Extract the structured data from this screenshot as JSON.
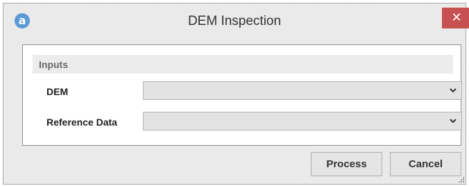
{
  "window": {
    "title": "DEM Inspection",
    "logo_glyph": "a",
    "logo_icon": "app-logo-icon",
    "close_glyph": "✕",
    "close_icon": "close-icon",
    "close_color": "#c75050"
  },
  "inputs": {
    "header": "Inputs",
    "fields": [
      {
        "label": "DEM",
        "value": "",
        "icon": "chevron-down-icon"
      },
      {
        "label": "Reference Data",
        "value": "",
        "icon": "chevron-down-icon"
      }
    ]
  },
  "buttons": {
    "process": "Process",
    "cancel": "Cancel"
  }
}
